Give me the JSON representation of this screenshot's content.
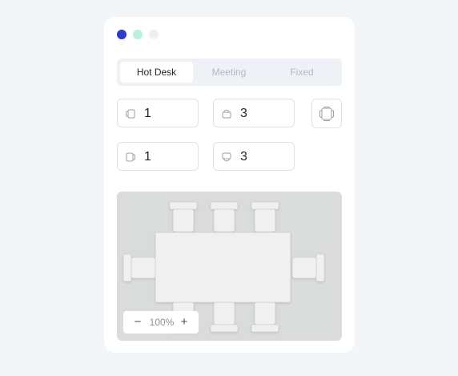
{
  "window_dots": [
    {
      "name": "dot-blue",
      "color": "#2d3ad0"
    },
    {
      "name": "dot-mint",
      "color": "#b8f2dc"
    },
    {
      "name": "dot-gray",
      "color": "#eef1f4"
    }
  ],
  "tabs": [
    {
      "label": "Hot Desk",
      "active": true
    },
    {
      "label": "Meeting",
      "active": false
    },
    {
      "label": "Fixed",
      "active": false
    }
  ],
  "fields": {
    "left_chairs": {
      "value": "1",
      "icon": "chair-side-icon"
    },
    "top_chairs": {
      "value": "3",
      "icon": "chair-top-icon"
    },
    "right_chairs": {
      "value": "1",
      "icon": "chair-right-icon"
    },
    "bottom_chairs": {
      "value": "3",
      "icon": "chair-bottom-icon"
    }
  },
  "rotate_button": {
    "icon": "table-layout-icon"
  },
  "preview": {
    "zoom_out_label": "−",
    "zoom_level": "100%",
    "zoom_in_label": "+"
  },
  "colors": {
    "accent": "#2d3ad0",
    "preview_bg": "#d9dcda",
    "furniture": "#eff0ef"
  }
}
